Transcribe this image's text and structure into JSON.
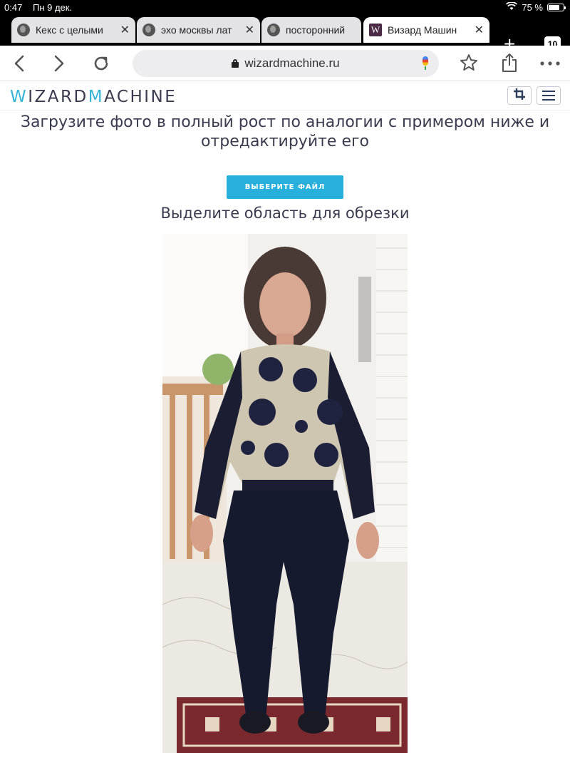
{
  "status_bar": {
    "time": "0:47",
    "date": "Пн 9 дек.",
    "battery": "75 %",
    "battery_level": 0.75
  },
  "tabs": [
    {
      "title": "Кекс с целыми",
      "icon": "globe-icon",
      "active": false
    },
    {
      "title": "эхо москвы лат",
      "icon": "globe-icon",
      "active": false
    },
    {
      "title": "посторонний",
      "icon": "globe-icon",
      "active": false
    },
    {
      "title": "Визард Машин",
      "icon": "wizard-favicon",
      "favicon_letter": "W",
      "active": true
    }
  ],
  "tab_count": "10",
  "toolbar": {
    "url": "wizardmachine.ru"
  },
  "site": {
    "logo_parts": [
      "W",
      "IZARD",
      "M",
      "ACHINE"
    ],
    "accent_color": "#36b4d8",
    "text_color": "#3b3b4f"
  },
  "page": {
    "instruction_line1": "Загрузите фото в полный рост по аналогии с примером ниже и",
    "instruction_line2": "отредактируйте его",
    "choose_file_label": "ВЫБЕРИТЕ ФАЙЛ",
    "button_color": "#27b0dc",
    "crop_heading": "Выделите область для обрезки"
  }
}
